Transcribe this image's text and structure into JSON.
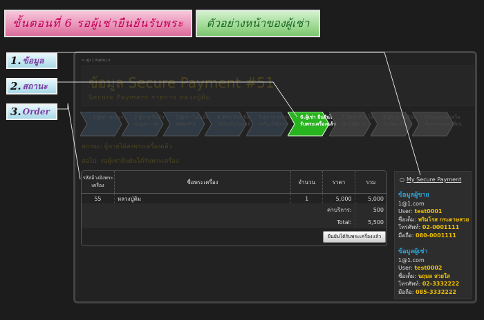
{
  "banners": {
    "step": "ขั้นตอนที่ 6  รอผู้เช่ายืนยันรับพระ",
    "sample": "ตัวอย่างหน้าของผู้เช่า"
  },
  "callouts": [
    {
      "num": "1.",
      "text": "ข้อมูล"
    },
    {
      "num": "2.",
      "text": "สถานะ"
    },
    {
      "num": "3.",
      "text": "Order"
    }
  ],
  "breadcrumb": "« up | menu »",
  "page": {
    "title": "ข้อมูล Secure Payment #51",
    "subtitle": "Secure Payment รายการ หลวงปู่ติม"
  },
  "steps": [
    {
      "label": "1.ผู้เช่า ตกลงราคา"
    },
    {
      "label": "2.ผู้ขาย ยืนยันข้อมูลการค้า"
    },
    {
      "label": "3.ผู้เช่า โอนเงินให้ Web-Pra"
    },
    {
      "label": "4.Web-Pra ยืนยันได้รับเงินโอนแล้ว"
    },
    {
      "label": "5.ผู้ขาย ส่งพระเครื่องให้ผู้เช่า"
    },
    {
      "label": "6.ผู้เช่า ยืนยันได้รับพระเครื่องแล้ว",
      "active": true
    },
    {
      "label": "7.Web-Pra โอนเงินให้ผู้ขาย"
    },
    {
      "label": "8.ผู้ขาย ยืนยันได้รับเงินแล้ว"
    },
    {
      "label": "9.Success เสร็จสิ้นการแลกเปลี่ยน"
    }
  ],
  "status": {
    "current": "สถานะ: ผู้ขายได้ส่งพระเครื่องแล้ว",
    "next": "ต่อไป: รอผู้เช่ายืนยันได้รับพระเครื่อง"
  },
  "order": {
    "headers": [
      "รหัสอ้างอิงพระเครื่อง",
      "ชื่อพระเครื่อง",
      "จำนวน",
      "ราคา",
      "รวม"
    ],
    "rows": [
      {
        "id": "55",
        "name": "หลวงปู่ติม",
        "qty": "1",
        "price": "5,000",
        "total": "5,000"
      }
    ],
    "service_label": "ค่าบริการ:",
    "service_value": "500",
    "total_label": "Total:",
    "total_value": "5,500",
    "confirm_button": "ยืนยันได้รับพระเครื่องแล้ว"
  },
  "sidebar": {
    "link": "My Secure Payment",
    "seller": {
      "heading": "ข้อมูลผู้ขาย",
      "email": "1@1.com",
      "user_label": "User:",
      "user": "test0001",
      "name_label": "ชื่อเต็ม:",
      "name": "พริมโรส กระดาษสวย",
      "phone_label": "โทรศัพท์:",
      "phone": "02-0001111",
      "mobile_label": "มือถือ:",
      "mobile": "080-0001111"
    },
    "buyer": {
      "heading": "ข้อมูลผู้เช่า",
      "email": "1@1.com",
      "user_label": "User:",
      "user": "test0002",
      "name_label": "ชื่อเต็ม:",
      "name": "นฤมล สวยใส",
      "phone_label": "โทรศัพท์:",
      "phone": "02-3332222",
      "mobile_label": "มือถือ:",
      "mobile": "085-3332222"
    }
  }
}
